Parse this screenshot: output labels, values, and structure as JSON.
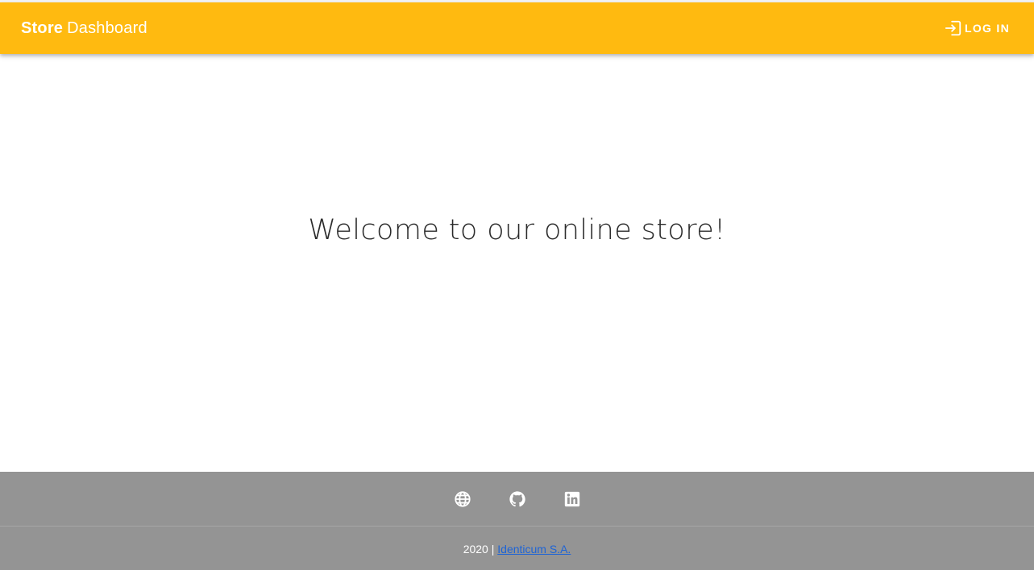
{
  "header": {
    "brand_bold": "Store",
    "brand_light": "Dashboard",
    "login_label": "LOG IN",
    "login_icon": "login-icon",
    "background_color": "#ffba10"
  },
  "main": {
    "welcome_text": "Welcome to our online store!"
  },
  "footer": {
    "icons": [
      "globe-icon",
      "github-icon",
      "linkedin-icon"
    ],
    "year": "2020",
    "separator": "|",
    "company_link": "Identicum S.A.",
    "background_color": "#949494",
    "link_color": "#1e64d6"
  }
}
